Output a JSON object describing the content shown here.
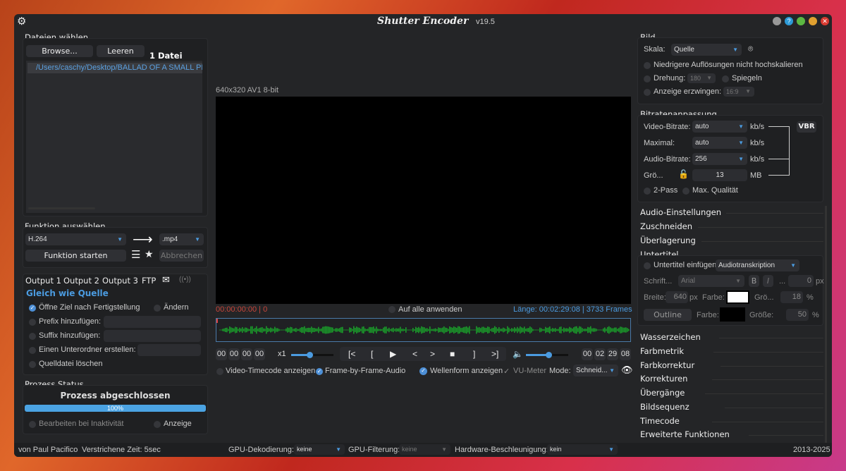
{
  "title": {
    "app": "Shutter Encoder",
    "version": "v19.5"
  },
  "files": {
    "heading": "Dateien wählen",
    "browse": "Browse...",
    "clear": "Leeren",
    "count": "1 Datei",
    "items": [
      "/Users/caschy/Desktop/BALLAD OF A SMALL PL"
    ]
  },
  "function": {
    "heading": "Funktion auswählen",
    "codec": "H.264",
    "container": ".mp4",
    "start": "Funktion starten",
    "cancel": "Abbrechen"
  },
  "output": {
    "tabs": [
      "Output 1",
      "Output 2",
      "Output 3",
      "FTP"
    ],
    "destination": "Gleich wie Quelle",
    "open_after": "Öffne Ziel nach Fertigstellung",
    "change": "Ändern",
    "prefix": "Prefix hinzufügen:",
    "suffix": "Suffix hinzufügen:",
    "subfolder": "Einen Unterordner erstellen:",
    "delete_source": "Quelldatei löschen"
  },
  "status": {
    "heading": "Prozess Status",
    "message": "Prozess abgeschlossen",
    "progress_label": "100%",
    "progress": 100,
    "idle": "Bearbeiten bei Inaktivität",
    "display": "Anzeige"
  },
  "player": {
    "info": "640x320 AV1 8-bit",
    "current": "00:00:00:00 | 0",
    "apply_all": "Auf alle anwenden",
    "length": "Länge: 00:02:29:08 | 3733 Frames",
    "in_tc": [
      "00",
      "00",
      "00",
      "00"
    ],
    "speed": "x1",
    "speed_level": 0.45,
    "volume_level": 0.55,
    "out_tc": [
      "00",
      "02",
      "29",
      "08"
    ],
    "buttons": [
      "[<",
      "[",
      "▶",
      "<",
      ">",
      "■",
      "]",
      ">]"
    ],
    "show_timecode": "Video-Timecode anzeigen",
    "frame_audio": "Frame-by-Frame-Audio",
    "waveform": "Wellenform anzeigen",
    "vu": "VU-Meter",
    "mode_label": "Mode:",
    "mode": "Schneid..."
  },
  "image": {
    "heading": "Bild",
    "scale_label": "Skala:",
    "scale": "Quelle",
    "no_upscale": "Niedrigere Auflösungen nicht hochskalieren",
    "rotation_label": "Drehung:",
    "rotation": "180",
    "mirror": "Spiegeln",
    "force_label": "Anzeige erzwingen:",
    "force": "16:9"
  },
  "bitrate": {
    "heading": "Bitratenanpassung",
    "video_label": "Video-Bitrate:",
    "video": "auto",
    "max_label": "Maximal:",
    "max": "auto",
    "audio_label": "Audio-Bitrate:",
    "audio": "256",
    "size_label": "Grö...",
    "size": "13",
    "kbs": "kb/s",
    "mb": "MB",
    "vbr": "VBR",
    "twopass": "2-Pass",
    "maxq": "Max. Qualität"
  },
  "sections": [
    "Audio-Einstellungen",
    "Zuschneiden",
    "Überlagerung"
  ],
  "subtitles": {
    "heading": "Untertitel",
    "insert": "Untertitel einfügen:",
    "insert_value": "Audiotranskription",
    "font_label": "Schrift...",
    "font": "Arial",
    "bold": "B",
    "italic": "I",
    "dots": "...",
    "offset": "0",
    "px": "px",
    "width_label": "Breite:",
    "width": "640",
    "color_label": "Farbe:",
    "size_label": "Grö...",
    "size": "18",
    "pct": "%",
    "outline": "Outline",
    "size2_label": "Größe:",
    "size2": "50"
  },
  "sections2": [
    "Wasserzeichen",
    "Farbmetrik",
    "Farbkorrektur",
    "Korrekturen",
    "Übergänge",
    "Bildsequenz",
    "Timecode",
    "Erweiterte Funktionen"
  ],
  "footer": {
    "author": "von Paul Pacifico",
    "elapsed": "Verstrichene Zeit: 5sec",
    "gpu_dec_label": "GPU-Dekodierung:",
    "gpu_dec": "keine",
    "gpu_filter_label": "GPU-Filterung:",
    "gpu_filter": "keine",
    "hw_label": "Hardware-Beschleunigung:",
    "hw": "kein",
    "years": "2013-2025"
  }
}
